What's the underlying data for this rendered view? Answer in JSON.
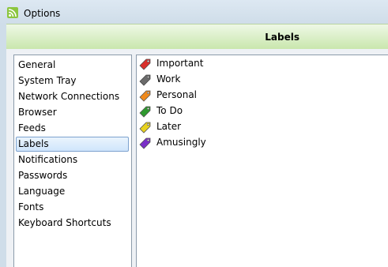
{
  "window": {
    "title": "Options",
    "icon": "rss-feed-icon"
  },
  "header": {
    "title": "Labels"
  },
  "nav": {
    "selected": "Labels",
    "items": [
      {
        "label": "General"
      },
      {
        "label": "System Tray"
      },
      {
        "label": "Network Connections"
      },
      {
        "label": "Browser"
      },
      {
        "label": "Feeds"
      },
      {
        "label": "Labels"
      },
      {
        "label": "Notifications"
      },
      {
        "label": "Passwords"
      },
      {
        "label": "Language"
      },
      {
        "label": "Fonts"
      },
      {
        "label": "Keyboard Shortcuts"
      }
    ]
  },
  "labels": {
    "items": [
      {
        "name": "Important",
        "color": "#d9302c",
        "icon": "red-tag-icon"
      },
      {
        "name": "Work",
        "color": "#6b6b6b",
        "icon": "gray-tag-icon"
      },
      {
        "name": "Personal",
        "color": "#f08a1c",
        "icon": "orange-tag-icon"
      },
      {
        "name": "To Do",
        "color": "#2f9a2f",
        "icon": "green-tag-icon"
      },
      {
        "name": "Later",
        "color": "#e8d21e",
        "icon": "yellow-tag-icon"
      },
      {
        "name": "Amusingly",
        "color": "#7a2fc8",
        "icon": "purple-tag-icon"
      }
    ]
  },
  "colors": {
    "header_band_top": "#eef8e6",
    "header_band_bottom": "#c8e6ab",
    "selection_border": "#7da2ce"
  }
}
